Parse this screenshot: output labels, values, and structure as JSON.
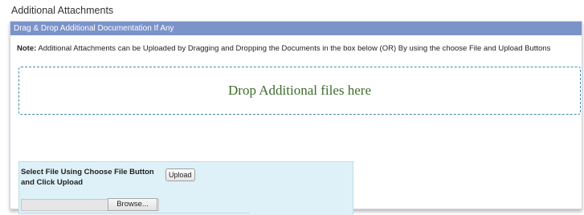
{
  "section": {
    "title": "Additional Attachments"
  },
  "panel": {
    "header": "Drag & Drop Additional Documentation If Any",
    "note_prefix": "Note:",
    "note_text": "Additional Attachments can be Uploaded by Dragging and Dropping the Documents in the box below (OR) By using the choose File and Upload Buttons"
  },
  "dropzone": {
    "label": "Drop Additional files here"
  },
  "upload": {
    "label": "Select File Using Choose File Button and Click Upload",
    "upload_button": "Upload",
    "browse_button": "Browse..."
  },
  "colors": {
    "header_bg": "#7b93c9",
    "dropzone_border": "#3f8aa8",
    "dropzone_text": "#3d6b2b",
    "upload_bg": "#def0f8"
  }
}
